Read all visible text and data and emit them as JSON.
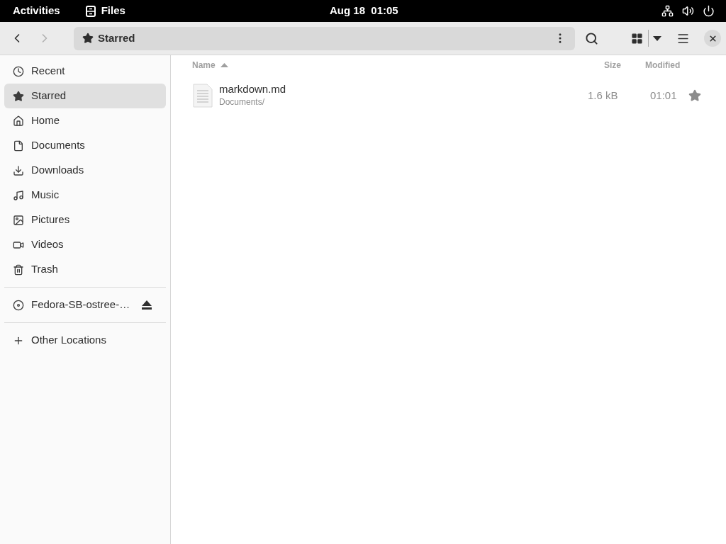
{
  "top_bar": {
    "activities": "Activities",
    "app": "Files",
    "clock": "Aug 18  01:05"
  },
  "header": {
    "location": "Starred"
  },
  "sidebar": {
    "places": [
      {
        "label": "Recent",
        "kind": "recent",
        "selected": false
      },
      {
        "label": "Starred",
        "kind": "starred",
        "selected": true
      },
      {
        "label": "Home",
        "kind": "home",
        "selected": false
      },
      {
        "label": "Documents",
        "kind": "documents",
        "selected": false
      },
      {
        "label": "Downloads",
        "kind": "downloads",
        "selected": false
      },
      {
        "label": "Music",
        "kind": "music",
        "selected": false
      },
      {
        "label": "Pictures",
        "kind": "pictures",
        "selected": false
      },
      {
        "label": "Videos",
        "kind": "videos",
        "selected": false
      },
      {
        "label": "Trash",
        "kind": "trash",
        "selected": false
      }
    ],
    "devices": [
      {
        "label": "Fedora-SB-ostree-…",
        "kind": "disc",
        "selected": false
      }
    ],
    "other": [
      {
        "label": "Other Locations",
        "kind": "other",
        "selected": false
      }
    ]
  },
  "table": {
    "columns": [
      {
        "label": "Name",
        "sorted": true
      },
      {
        "label": "Size",
        "sorted": false
      },
      {
        "label": "Modified",
        "sorted": false
      }
    ],
    "rows": [
      {
        "name": "markdown.md",
        "path": "Documents/",
        "size": "1.6 kB",
        "modified": "01:01",
        "starred": true
      }
    ]
  }
}
